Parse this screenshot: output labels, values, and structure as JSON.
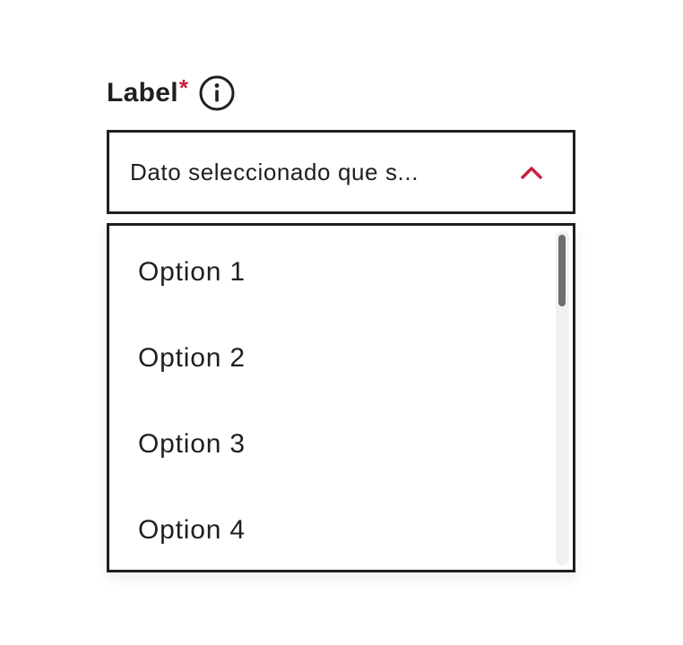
{
  "field": {
    "label": "Label",
    "required_marker": "*",
    "info_icon": "info-icon"
  },
  "select": {
    "value": "Dato seleccionado que s...",
    "expanded": true,
    "chevron_icon": "chevron-up-icon"
  },
  "options": [
    {
      "label": "Option 1"
    },
    {
      "label": "Option 2"
    },
    {
      "label": "Option 3"
    },
    {
      "label": "Option 4"
    }
  ],
  "colors": {
    "text": "#1f1f1f",
    "accent": "#c8203e",
    "scroll_thumb": "#6e6e6e",
    "scroll_track": "#f1f1f1"
  }
}
